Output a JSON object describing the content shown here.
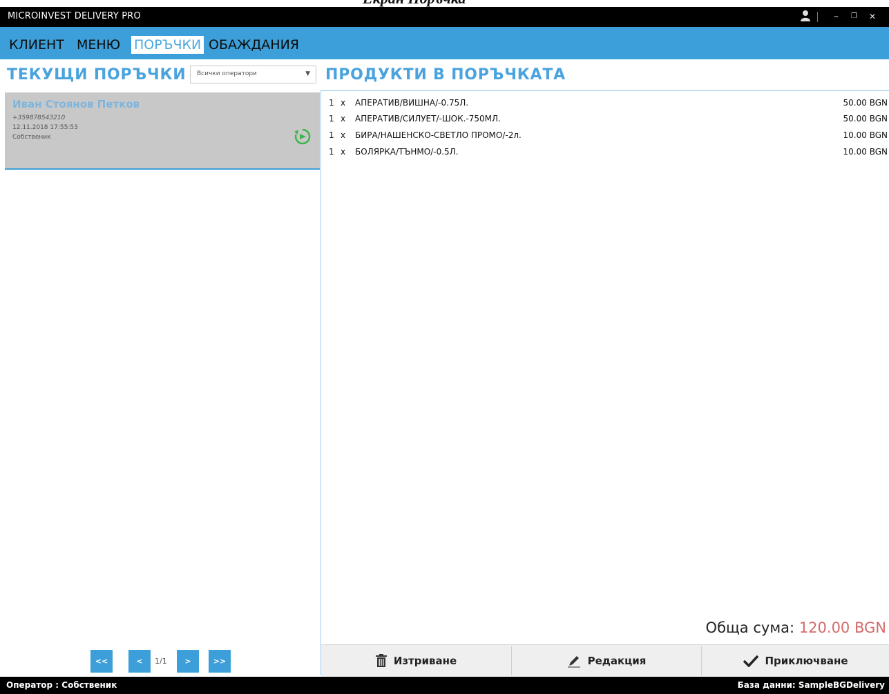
{
  "caption": "Екран Поръчка",
  "titlebar": {
    "title": "MICROINVEST DELIVERY PRO",
    "user_icon": "user-icon",
    "minimize_glyph": "–",
    "restore_glyph": "❐",
    "close_glyph": "✕"
  },
  "menu": {
    "tabs": [
      {
        "label": "КЛИЕНТ"
      },
      {
        "label": "МЕНЮ"
      },
      {
        "label": "ПОРЪЧКИ",
        "active": true
      },
      {
        "label": "ОБАЖДАНИЯ"
      }
    ]
  },
  "left": {
    "title": "ТЕКУЩИ ПОРЪЧКИ",
    "operator_filter": "Всички оператори",
    "orders": [
      {
        "name": "Иван Стоянов Петков",
        "phone": "+359878543210",
        "datetime": "12.11.2018 17:55:53",
        "operator": "Собственик"
      }
    ],
    "pager": {
      "first": "<<",
      "prev": "<",
      "label": "1/1",
      "next": ">",
      "last": ">>"
    }
  },
  "right": {
    "title": "ПРОДУКТИ В ПОРЪЧКАТА",
    "products": [
      {
        "qty": "1",
        "x": "x",
        "name": "АПЕРАТИВ/ВИШНА/-0.75Л.",
        "price": "50.00 BGN"
      },
      {
        "qty": "1",
        "x": "x",
        "name": "АПЕРАТИВ/СИЛУЕТ/-ШОК.-750МЛ.",
        "price": "50.00 BGN"
      },
      {
        "qty": "1",
        "x": "x",
        "name": "БИРА/НАШЕНСКО-СВЕТЛО ПРОМО/-2л.",
        "price": "10.00 BGN"
      },
      {
        "qty": "1",
        "x": "x",
        "name": "БОЛЯРКА/ТЪНМО/-0.5Л.",
        "price": "10.00 BGN"
      }
    ],
    "total_label": "Обща сума:",
    "total_value": "120.00 BGN",
    "actions": {
      "delete": "Изтриване",
      "edit": "Редакция",
      "complete": "Приключване"
    }
  },
  "status": {
    "operator": "Оператор : Собственик",
    "database": "База данни: SampleBGDelivery"
  },
  "colors": {
    "accent": "#3c9fd9",
    "title_blue": "#4aa3df",
    "total_red": "#d46a6a",
    "refresh_green": "#3cb54a"
  }
}
